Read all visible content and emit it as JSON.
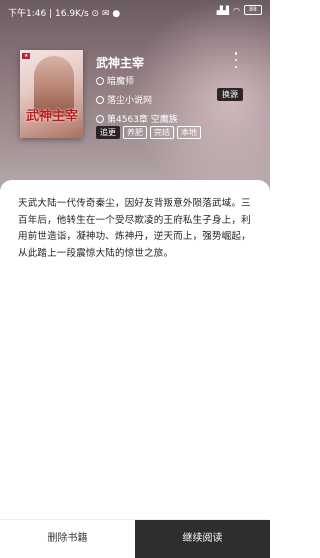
{
  "status_bar": {
    "time": "下午1:46",
    "speed": "16.9K/s",
    "battery": "88"
  },
  "book": {
    "title": "武神主宰",
    "author": "暗魔师",
    "source": "落尘小说网",
    "chapter": "第4563章 空魔族",
    "cover_title": "武神主宰",
    "switch_source_label": "换源",
    "tags": [
      "追更",
      "养肥",
      "完结",
      "本地"
    ],
    "intro": "天武大陆一代传奇秦尘，因好友背叛意外陨落武域。三百年后，他转生在一个受尽欺凌的王府私生子身上，利用前世造诣，凝神功、炼神丹，逆天而上，强势崛起，从此踏上一段震惊大陆的惊世之旅。"
  },
  "actions": {
    "delete_label": "删除书籍",
    "continue_label": "继续阅读"
  },
  "colors": {
    "header_bg": "#8a767a",
    "dark_button": "#2e2e2e"
  }
}
